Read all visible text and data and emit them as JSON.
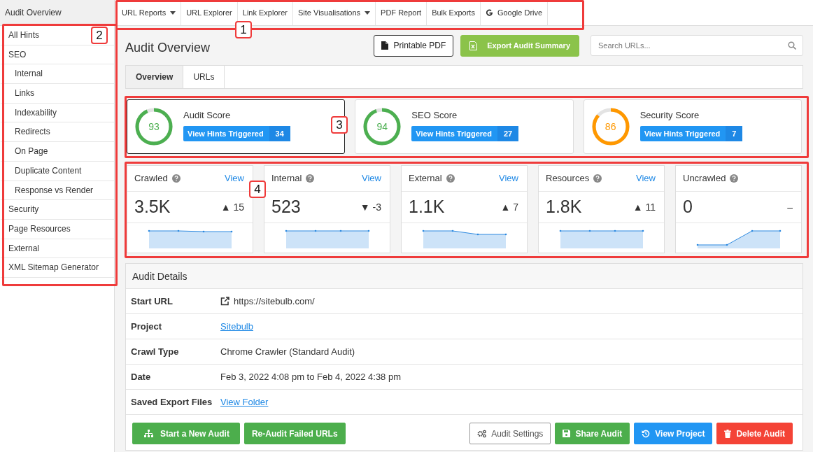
{
  "sidebar": {
    "title": "Audit Overview",
    "items": [
      {
        "label": "All Hints"
      },
      {
        "label": "SEO",
        "children": [
          {
            "label": "Internal"
          },
          {
            "label": "Links"
          },
          {
            "label": "Indexability"
          },
          {
            "label": "Redirects"
          },
          {
            "label": "On Page"
          },
          {
            "label": "Duplicate Content"
          },
          {
            "label": "Response vs Render"
          }
        ]
      },
      {
        "label": "Security"
      },
      {
        "label": "Page Resources"
      },
      {
        "label": "External"
      },
      {
        "label": "XML Sitemap Generator"
      }
    ]
  },
  "top_nav": [
    {
      "label": "URL Reports",
      "kind": "dropdown"
    },
    {
      "label": "URL Explorer",
      "kind": "link"
    },
    {
      "label": "Link Explorer",
      "kind": "link"
    },
    {
      "label": "Site Visualisations",
      "kind": "dropdown"
    },
    {
      "label": "PDF Report",
      "kind": "link"
    },
    {
      "label": "Bulk Exports",
      "kind": "link"
    },
    {
      "label": "Google Drive",
      "kind": "drive"
    }
  ],
  "page": {
    "title": "Audit Overview",
    "actions": [
      {
        "label": "Printable PDF",
        "kind": "outline"
      },
      {
        "label": "Export Audit Summary",
        "kind": "export"
      }
    ],
    "search": {
      "placeholder": "Search URLs..."
    }
  },
  "tabs": [
    {
      "label": "Overview",
      "selected": true
    },
    {
      "label": "URLs",
      "selected": false
    }
  ],
  "scores": [
    {
      "title": "Audit Score",
      "score": "93",
      "level": 0.93,
      "color": "#4caf50",
      "button": "View Hints Triggered",
      "count": "34",
      "selected": true
    },
    {
      "title": "SEO Score",
      "score": "94",
      "level": 0.94,
      "color": "#4caf50",
      "button": "View Hints Triggered",
      "count": "27",
      "selected": false
    },
    {
      "title": "Security Score",
      "score": "86",
      "level": 0.86,
      "color": "#ff9800",
      "button": "View Hints Triggered",
      "count": "7",
      "selected": false
    }
  ],
  "stats": [
    {
      "label": "Crawled",
      "link": "View",
      "value": "3.5K",
      "change": "▲ 15"
    },
    {
      "label": "Internal",
      "link": "View",
      "value": "523",
      "change": "▼ -3"
    },
    {
      "label": "External",
      "link": "View",
      "value": "1.1K",
      "change": "▲ 7"
    },
    {
      "label": "Resources",
      "link": "View",
      "value": "1.8K",
      "change": "▲ 11"
    },
    {
      "label": "Uncrawled",
      "value": "0",
      "change": "–"
    }
  ],
  "audit_details": {
    "title": "Audit Details",
    "rows": [
      {
        "label": "Start URL",
        "value": "https://sitebulb.com/",
        "kind": "external"
      },
      {
        "label": "Project",
        "value": "Sitebulb",
        "kind": "link"
      },
      {
        "label": "Crawl Type",
        "value": "Chrome Crawler (Standard Audit)",
        "kind": "text"
      },
      {
        "label": "Date",
        "value": "Feb 3, 2022 4:08 pm to Feb 4, 2022 4:38 pm",
        "kind": "text"
      },
      {
        "label": "Saved Export Files",
        "value": "View Folder",
        "kind": "link"
      }
    ],
    "buttons_left": [
      {
        "label": "Start a New Audit",
        "kind": "success"
      },
      {
        "label": "Re-Audit Failed URLs",
        "kind": "success"
      }
    ],
    "buttons_right": [
      {
        "label": "Audit Settings",
        "kind": "default"
      },
      {
        "label": "Share Audit",
        "kind": "success"
      },
      {
        "label": "View Project",
        "kind": "primary"
      },
      {
        "label": "Delete Audit",
        "kind": "danger"
      }
    ]
  },
  "callouts": [
    {
      "label": "1"
    },
    {
      "label": "2"
    },
    {
      "label": "3"
    },
    {
      "label": "4"
    }
  ]
}
